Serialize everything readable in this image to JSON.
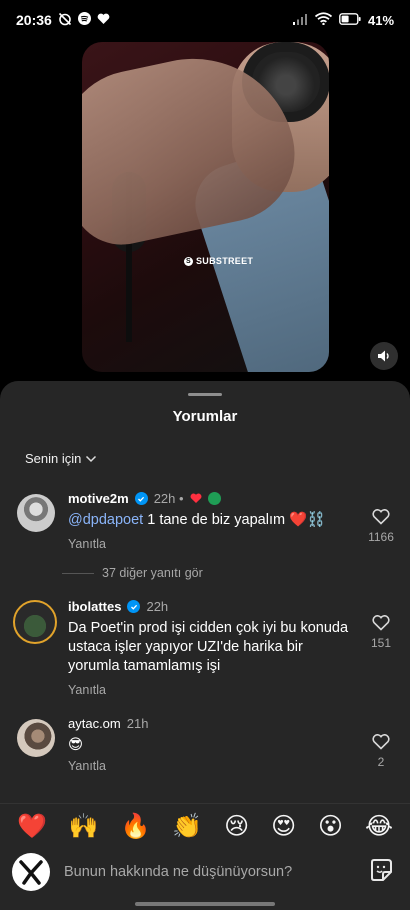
{
  "status": {
    "time": "20:36",
    "battery": "41"
  },
  "video": {
    "watermark": "SUBSTREET"
  },
  "sheet": {
    "title": "Yorumlar",
    "filter": "Senin için"
  },
  "comments": [
    {
      "user": "motive2m",
      "verified": true,
      "time": "22h",
      "mention": "@dpdapoet",
      "text": " 1 tane de biz yapalım ❤️⛓️",
      "reply": "Yanıtla",
      "likes": "1166"
    },
    {
      "user": "ibolattes",
      "verified": true,
      "time": "22h",
      "text": "Da Poet'in prod işi cidden çok iyi bu konuda ustaca işler yapıyor UZI'de harika bir yorumla tamamlamış işi",
      "reply": "Yanıtla",
      "likes": "151"
    },
    {
      "user": "aytac.om",
      "verified": false,
      "time": "21h",
      "text": "😎",
      "reply": "Yanıtla",
      "likes": "2"
    }
  ],
  "more_replies": "37 diğer yanıtı gör",
  "emojis": [
    "❤️",
    "🙌",
    "🔥",
    "👏",
    "😢",
    "😍",
    "😮",
    "😂"
  ],
  "input": {
    "placeholder": "Bunun hakkında ne düşünüyorsun?"
  },
  "colors": {
    "sheet_bg": "#262626",
    "verified": "#0095f6",
    "mention": "#8ab4f8"
  }
}
